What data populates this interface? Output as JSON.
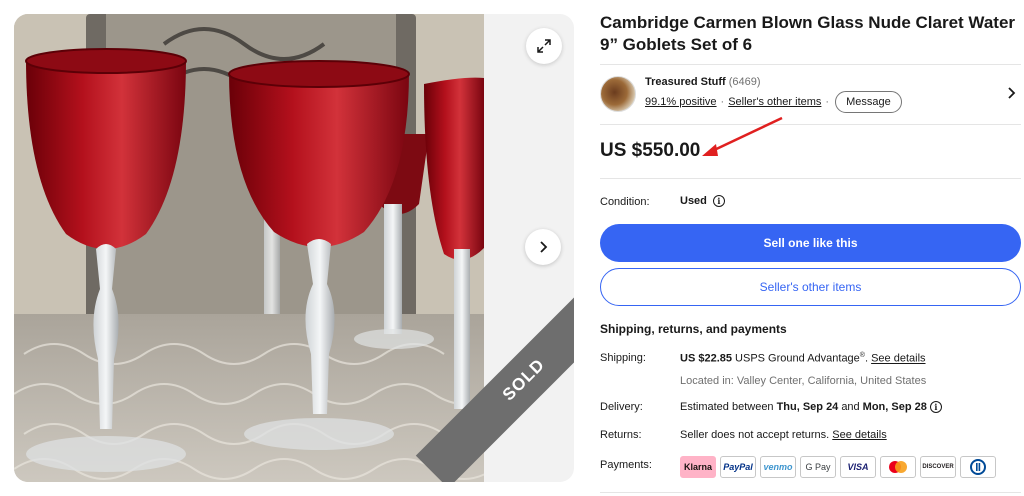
{
  "listing": {
    "title": "Cambridge Carmen Blown Glass Nude Claret Water 9” Goblets Set of 6",
    "sold_badge": "SOLD"
  },
  "seller": {
    "name": "Treasured Stuff",
    "feedback_count": "(6469)",
    "positive": "99.1% positive",
    "other_items": "Seller's other items",
    "separator": "·",
    "message_label": "Message"
  },
  "price": {
    "value": "US $550.00"
  },
  "condition": {
    "label": "Condition:",
    "value": "Used",
    "info": "i"
  },
  "actions": {
    "sell_one": "Sell one like this",
    "sellers_other_items": "Seller's other items"
  },
  "shipping_section": {
    "heading": "Shipping, returns, and payments",
    "shipping_label": "Shipping:",
    "shipping_cost": "US $22.85",
    "shipping_service": "USPS Ground Advantage",
    "registered_mark": "®",
    "period": ".",
    "see_details": "See details",
    "located_in": "Located in: Valley Center, California, United States",
    "delivery_label": "Delivery:",
    "delivery_prefix": "Estimated between",
    "delivery_start": "Thu, Sep 24",
    "delivery_and": "and",
    "delivery_end": "Mon, Sep 28",
    "returns_label": "Returns:",
    "returns_text": "Seller does not accept returns.",
    "returns_see_details": "See details",
    "payments_label": "Payments:"
  },
  "payments": [
    {
      "name": "Klarna",
      "bg": "#ffb3c7",
      "color": "#17120f"
    },
    {
      "name": "PayPal",
      "bg": "#ffffff",
      "color": "#003087"
    },
    {
      "name": "venmo",
      "bg": "#ffffff",
      "color": "#3d95ce"
    },
    {
      "name": "G Pay",
      "bg": "#ffffff",
      "color": "#3c4043"
    },
    {
      "name": "VISA",
      "bg": "#ffffff",
      "color": "#1a1f71"
    },
    {
      "name": "Mastercard",
      "bg": "#ffffff",
      "color": "#eb001b"
    },
    {
      "name": "DISCOVER",
      "bg": "#ffffff",
      "color": "#231f20"
    },
    {
      "name": "Diners Club",
      "bg": "#ffffff",
      "color": "#004a97"
    }
  ],
  "colors": {
    "accent": "#3665f3",
    "annotation_arrow": "#e02020",
    "sold_ribbon": "#6e6e6e",
    "goblet_red": "#b0101c"
  }
}
